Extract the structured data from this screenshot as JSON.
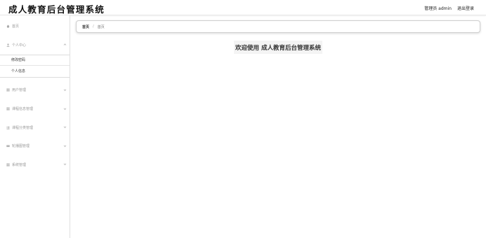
{
  "header": {
    "title": "成人教育后台管理系统",
    "user_label": "管理员 admin",
    "logout_label": "退出登录"
  },
  "sidebar": {
    "items": [
      {
        "label": "首页",
        "icon": "home-icon"
      },
      {
        "label": "个人中心",
        "icon": "user-icon",
        "expanded": true,
        "children": [
          {
            "label": "修改密码"
          },
          {
            "label": "个人信息"
          }
        ]
      },
      {
        "label": "用户管理",
        "icon": "grid-icon"
      },
      {
        "label": "课程信息管理",
        "icon": "grid-icon"
      },
      {
        "label": "课程分类管理",
        "icon": "list-icon"
      },
      {
        "label": "轮播图管理",
        "icon": "card-icon"
      },
      {
        "label": "系统管理",
        "icon": "grid-icon"
      }
    ]
  },
  "breadcrumb": {
    "home": "首页",
    "separator": "/",
    "current": "首页"
  },
  "main": {
    "welcome": "欢迎使用 成人教育后台管理系统"
  },
  "colors": {
    "accent": "#333333",
    "sidebar_text": "#9a9a9a"
  }
}
